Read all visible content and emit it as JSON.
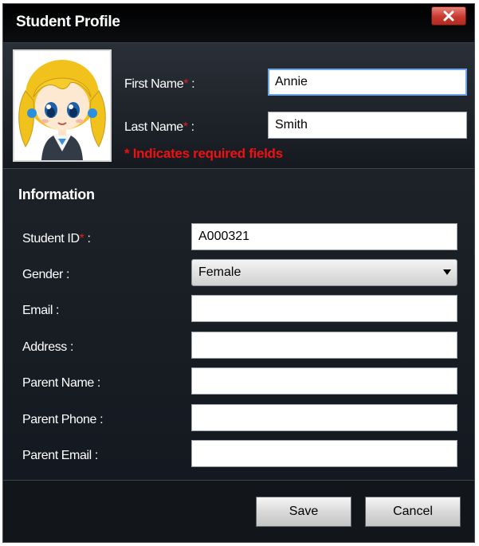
{
  "window": {
    "title": "Student Profile"
  },
  "profile": {
    "first_name": {
      "label": "First Name",
      "required_mark": "*",
      "suffix": " :",
      "value": "Annie"
    },
    "last_name": {
      "label": "Last Name",
      "required_mark": "*",
      "suffix": " :",
      "value": "Smith"
    },
    "required_note": "* Indicates required fields"
  },
  "information": {
    "title": "Information",
    "student_id": {
      "label": "Student ID",
      "required_mark": "*",
      "suffix": " :",
      "value": "A000321"
    },
    "gender": {
      "label": "Gender :",
      "value": "Female"
    },
    "email": {
      "label": "Email :",
      "value": ""
    },
    "address": {
      "label": "Address :",
      "value": ""
    },
    "parent_name": {
      "label": "Parent Name :",
      "value": ""
    },
    "parent_phone": {
      "label": "Parent Phone :",
      "value": ""
    },
    "parent_email": {
      "label": "Parent Email :",
      "value": ""
    }
  },
  "buttons": {
    "save": "Save",
    "cancel": "Cancel"
  },
  "icons": {
    "close": "close-icon",
    "avatar": "student-avatar-icon",
    "dropdown": "chevron-down-icon"
  },
  "colors": {
    "required": "#e02020",
    "note": "#ee1111",
    "close_button": "#c8392e",
    "focus_border": "#6ba7e8"
  }
}
